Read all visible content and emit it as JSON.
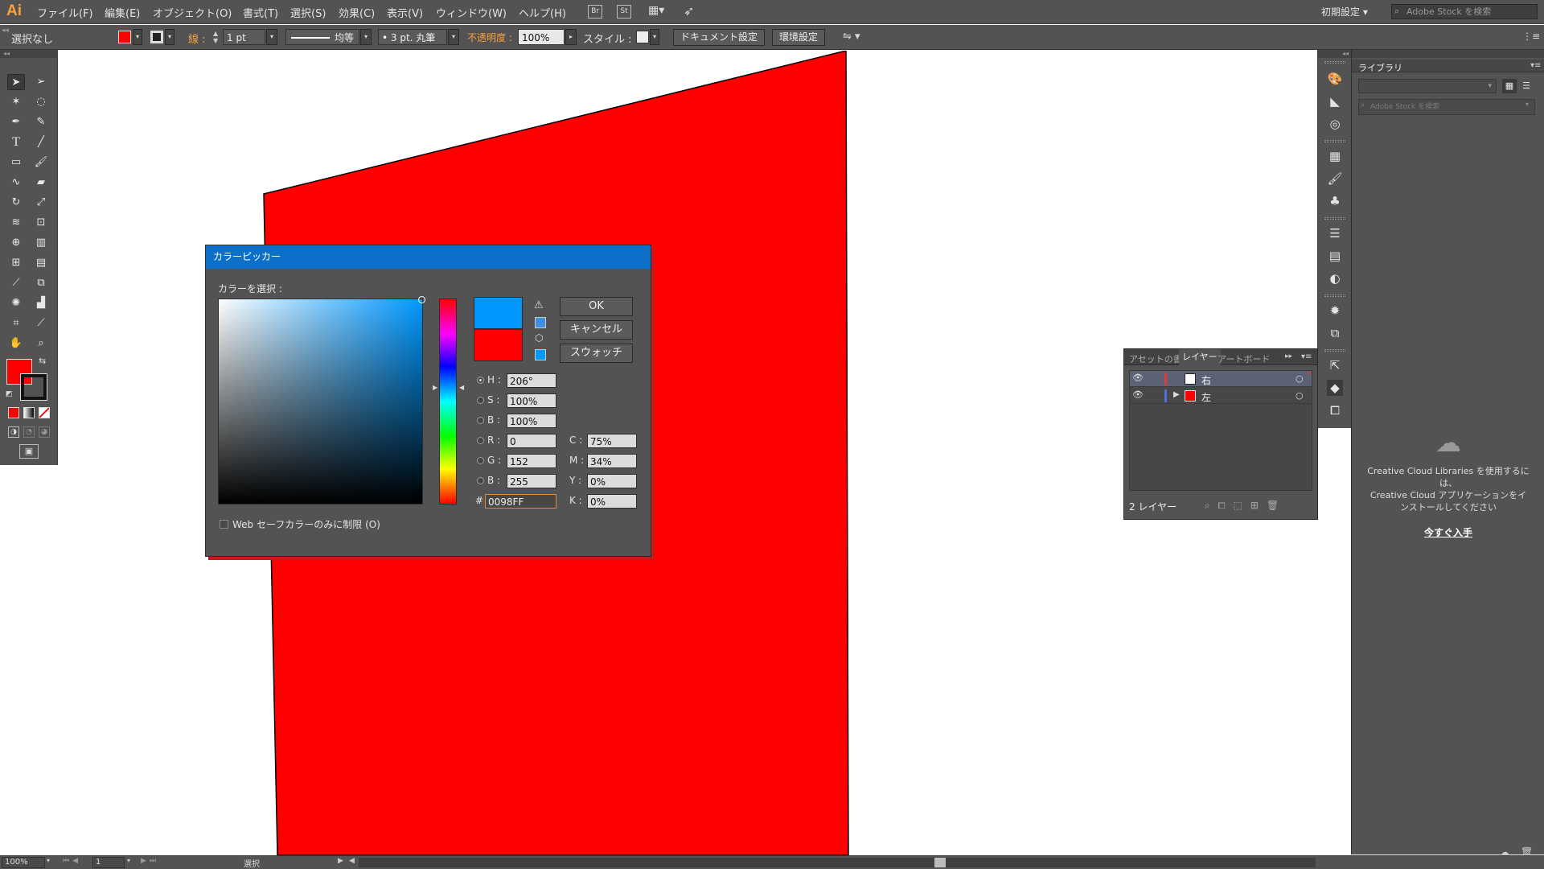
{
  "app": {
    "logo": "Ai",
    "colors": {
      "accent": "#0c6fc8",
      "logo": "#f7a23a",
      "ui_bg": "#535353",
      "shape_fill": "#ff0000"
    }
  },
  "menubar": {
    "items": [
      "ファイル(F)",
      "編集(E)",
      "オブジェクト(O)",
      "書式(T)",
      "選択(S)",
      "効果(C)",
      "表示(V)",
      "ウィンドウ(W)",
      "ヘルプ(H)"
    ],
    "bridge_label": "Br",
    "stock_label": "St",
    "workspace": "初期設定",
    "search_placeholder": "Adobe Stock を検索"
  },
  "controlbar": {
    "selection": "選択なし",
    "stroke_label": "線 :",
    "stroke_weight": "1 pt",
    "stroke_profile": "均等",
    "brush": "3 pt. 丸筆",
    "opacity_label": "不透明度 :",
    "opacity_value": "100%",
    "style_label": "スタイル :",
    "document_settings": "ドキュメント設定",
    "preferences": "環境設定"
  },
  "color_picker": {
    "title": "カラーピッカー",
    "select_label": "カラーを選択 :",
    "ok": "OK",
    "cancel": "キャンセル",
    "swatches": "スウォッチ",
    "new_color": "#0098FF",
    "old_color": "#FF0000",
    "hsb": [
      {
        "label": "H :",
        "value": "206°",
        "selected": true
      },
      {
        "label": "S :",
        "value": "100%",
        "selected": false
      },
      {
        "label": "B :",
        "value": "100%",
        "selected": false
      }
    ],
    "rgb": [
      {
        "label": "R :",
        "value": "0"
      },
      {
        "label": "G :",
        "value": "152"
      },
      {
        "label": "B :",
        "value": "255"
      }
    ],
    "cmyk": [
      {
        "label": "C :",
        "value": "75%"
      },
      {
        "label": "M :",
        "value": "34%"
      },
      {
        "label": "Y :",
        "value": "0%"
      },
      {
        "label": "K :",
        "value": "0%"
      }
    ],
    "hex_label": "#",
    "hex_value": "0098FF",
    "web_safe_label": "Web セーフカラーのみに制限 (O)"
  },
  "layers_panel": {
    "tabs": [
      "アセットの書",
      "レイヤー",
      "アートボード"
    ],
    "active_tab": 1,
    "layers": [
      {
        "name": "右",
        "color": "#e33b3b",
        "thumb": "#ffffff",
        "expanded": false
      },
      {
        "name": "左",
        "color": "#4d6fe0",
        "thumb": "#ff0000",
        "expanded": true
      }
    ],
    "count_label": "2 レイヤー"
  },
  "libraries_panel": {
    "title": "ライブラリ",
    "search_placeholder": "Adobe Stock を検索",
    "message_1": "Creative Cloud Libraries を使用するには、",
    "message_2": "Creative Cloud アプリケーションをインストールしてください",
    "cta": "今すぐ入手"
  },
  "statusbar": {
    "zoom": "100%",
    "artboard": "1",
    "mode": "選択"
  }
}
